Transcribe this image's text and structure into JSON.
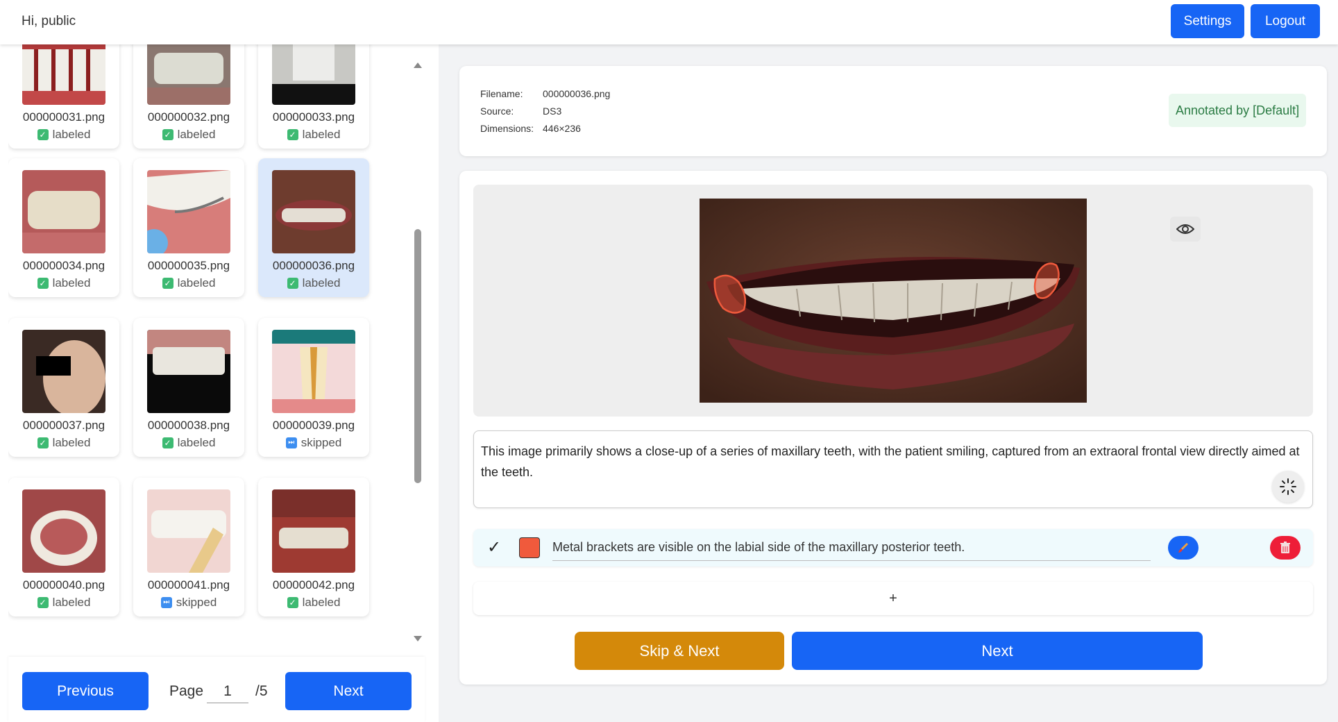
{
  "header": {
    "greeting": "Hi, public",
    "settings_label": "Settings",
    "logout_label": "Logout"
  },
  "gallery": {
    "items": [
      {
        "filename": "000000031.png",
        "status": "labeled"
      },
      {
        "filename": "000000032.png",
        "status": "labeled"
      },
      {
        "filename": "000000033.png",
        "status": "labeled"
      },
      {
        "filename": "000000034.png",
        "status": "labeled"
      },
      {
        "filename": "000000035.png",
        "status": "labeled"
      },
      {
        "filename": "000000036.png",
        "status": "labeled"
      },
      {
        "filename": "000000037.png",
        "status": "labeled"
      },
      {
        "filename": "000000038.png",
        "status": "labeled"
      },
      {
        "filename": "000000039.png",
        "status": "skipped"
      },
      {
        "filename": "000000040.png",
        "status": "labeled"
      },
      {
        "filename": "000000041.png",
        "status": "skipped"
      },
      {
        "filename": "000000042.png",
        "status": "labeled"
      }
    ],
    "selected": "000000036.png"
  },
  "pagination": {
    "previous_label": "Previous",
    "page_label": "Page",
    "current_page": "1",
    "total": "/5",
    "next_label": "Next"
  },
  "info": {
    "filename_key": "Filename:",
    "filename": "000000036.png",
    "source_key": "Source:",
    "source": "DS3",
    "dimensions_key": "Dimensions:",
    "dimensions": "446×236",
    "annotated_by": "Annotated by [Default]"
  },
  "description": "This image primarily shows a close-up of a series of maxillary teeth, with the patient smiling, captured from an extraoral frontal view directly aimed at the teeth.",
  "findings": [
    {
      "text": "Metal brackets are visible on the labial side of the maxillary posterior teeth.",
      "color": "#f05a3c",
      "checked": true
    }
  ],
  "add_label": "+",
  "actions": {
    "skip_next_label": "Skip & Next",
    "next_label": "Next"
  },
  "colors": {
    "primary": "#1765f5",
    "skip": "#d4890a",
    "delete": "#ee1e38",
    "labeled": "#3dba72",
    "skipped": "#3d8ef0"
  }
}
